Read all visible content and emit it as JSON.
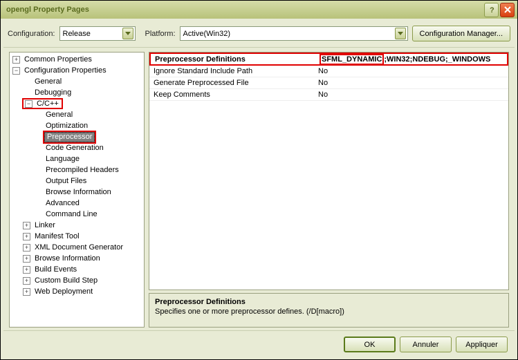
{
  "window": {
    "title": "opengl Property Pages"
  },
  "config": {
    "label": "Configuration:",
    "value": "Release",
    "platform_label": "Platform:",
    "platform_value": "Active(Win32)",
    "manager_button": "Configuration Manager..."
  },
  "tree": {
    "common": "Common Properties",
    "config_props": "Configuration Properties",
    "general": "General",
    "debugging": "Debugging",
    "ccpp": "C/C++",
    "ccpp_general": "General",
    "ccpp_optimization": "Optimization",
    "ccpp_preprocessor": "Preprocessor",
    "ccpp_codegen": "Code Generation",
    "ccpp_language": "Language",
    "ccpp_precompiled": "Precompiled Headers",
    "ccpp_output": "Output Files",
    "ccpp_browse": "Browse Information",
    "ccpp_advanced": "Advanced",
    "ccpp_cmdline": "Command Line",
    "linker": "Linker",
    "manifest": "Manifest Tool",
    "xmldoc": "XML Document Generator",
    "browseinfo": "Browse Information",
    "buildevents": "Build Events",
    "custombuild": "Custom Build Step",
    "webdeploy": "Web Deployment"
  },
  "grid": {
    "rows": [
      {
        "key": "Preprocessor Definitions",
        "val_hl": "SFML_DYNAMIC",
        "val_rest": ";WIN32;NDEBUG;_WINDOWS"
      },
      {
        "key": "Ignore Standard Include Path",
        "val": "No"
      },
      {
        "key": "Generate Preprocessed File",
        "val": "No"
      },
      {
        "key": "Keep Comments",
        "val": "No"
      }
    ]
  },
  "description": {
    "title": "Preprocessor Definitions",
    "text": "Specifies one or more preprocessor defines.     (/D[macro])"
  },
  "buttons": {
    "ok": "OK",
    "cancel": "Annuler",
    "apply": "Appliquer"
  }
}
